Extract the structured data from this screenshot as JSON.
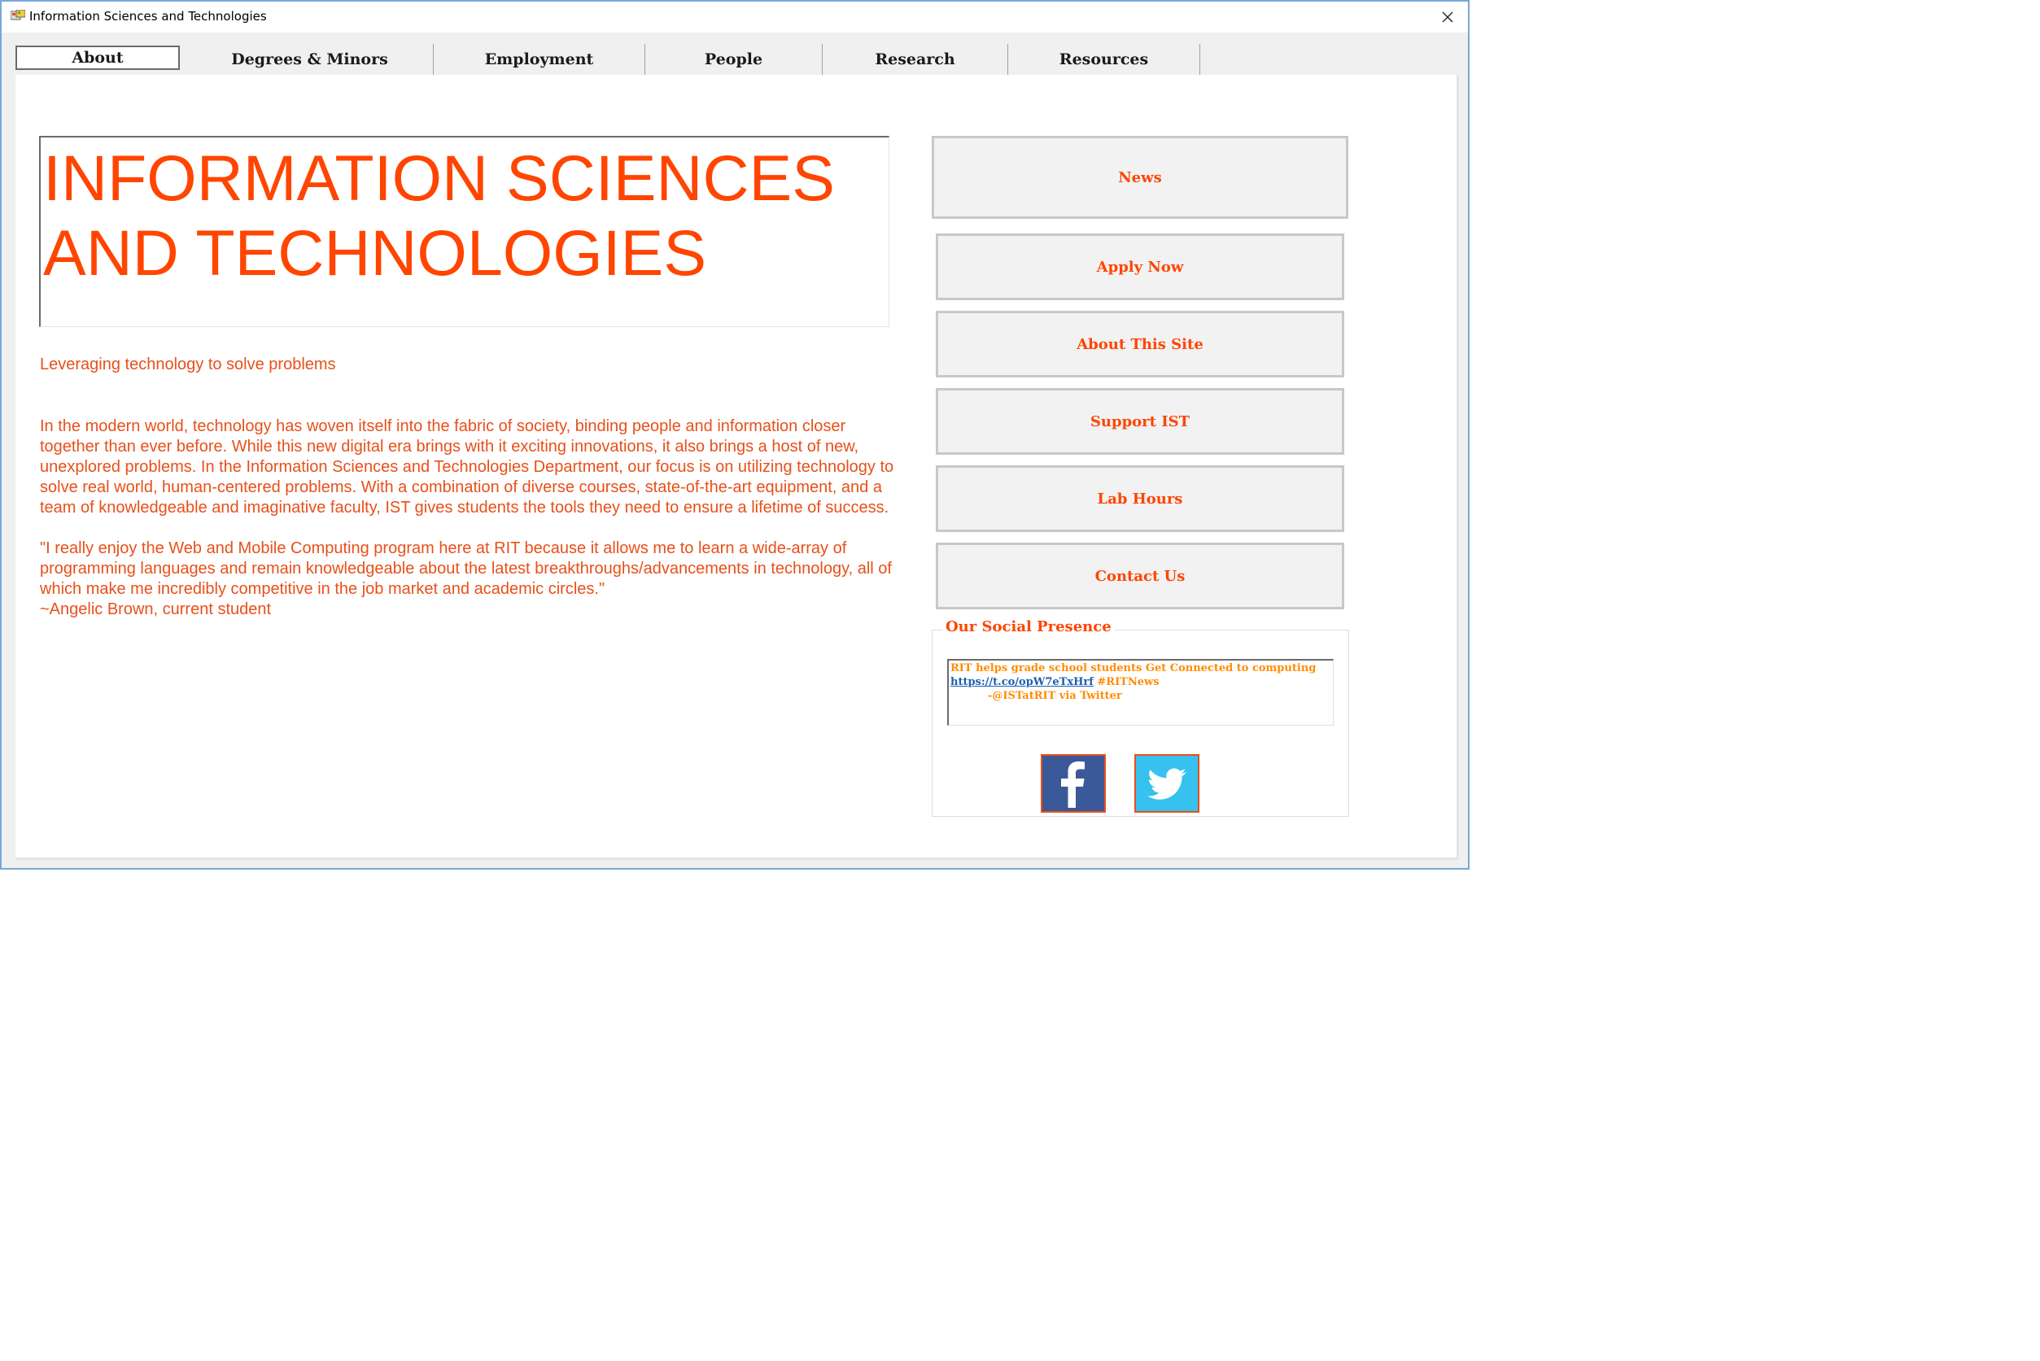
{
  "window": {
    "title": "Information Sciences and Technologies"
  },
  "tabs": [
    {
      "label": "About",
      "active": true
    },
    {
      "label": "Degrees & Minors"
    },
    {
      "label": "Employment"
    },
    {
      "label": "People"
    },
    {
      "label": "Research"
    },
    {
      "label": "Resources"
    }
  ],
  "main": {
    "heading": "INFORMATION SCIENCES AND TECHNOLOGIES",
    "tagline": "Leveraging technology to solve problems",
    "description": "In the modern world, technology has woven itself into the fabric of society, binding people and information closer together than ever before. While this new digital era brings with it exciting innovations, it also brings a host of new, unexplored problems. In the Information Sciences and Technologies Department, our focus is on utilizing technology to solve real world, human-centered problems. With a combination of diverse courses, state-of-the-art equipment, and a team of knowledgeable and imaginative faculty, IST gives students the tools they need to ensure a lifetime of success.",
    "quote": "\"I really enjoy the Web and Mobile Computing program here at RIT because it allows me to learn a wide-array of programming languages and remain knowledgeable about the latest breakthroughs/advancements in technology, all of which make me incredibly competitive in the job market and academic circles.\"\n~Angelic Brown, current student"
  },
  "sidebar": {
    "buttons": [
      {
        "label": "News"
      },
      {
        "label": "Apply Now"
      },
      {
        "label": "About This Site"
      },
      {
        "label": "Support IST"
      },
      {
        "label": "Lab Hours"
      },
      {
        "label": "Contact Us"
      }
    ]
  },
  "social": {
    "legend": "Our Social Presence",
    "tweet_text": "RIT helps grade school students Get Connected to computing",
    "tweet_link": "https://t.co/opW7eTxHrf",
    "tweet_hashtag": "#RITNews",
    "tweet_author": "-@ISTatRIT via Twitter",
    "icons": [
      "facebook-icon",
      "twitter-icon"
    ]
  },
  "colors": {
    "accent": "#ff4500",
    "tweet_text": "#ff8c00",
    "facebook": "#3b5998",
    "twitter": "#36c1ee"
  }
}
